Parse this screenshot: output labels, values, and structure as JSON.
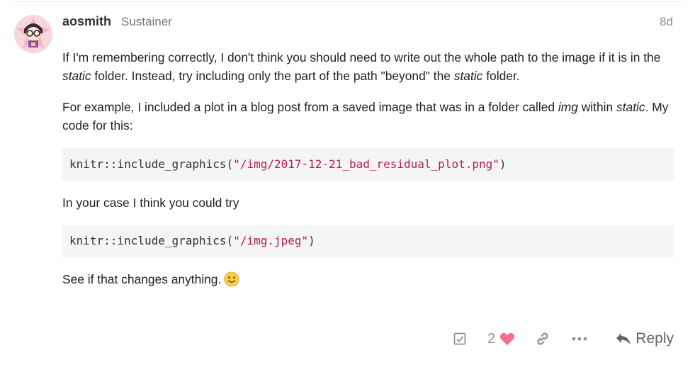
{
  "post": {
    "username": "aosmith",
    "user_title": "Sustainer",
    "age": "8d",
    "avatar_icon": "avatar-cartoon-icon",
    "paragraph1": {
      "a": "If I'm remembering correctly, I don't think you should need to write out the whole path to the image if it is in the ",
      "b": "static",
      "c": " folder. Instead, try including only the part of the path \"beyond\" the ",
      "d": "static",
      "e": " folder."
    },
    "paragraph2": {
      "a": "For example, I included a plot in a blog post from a saved image that was in a folder called ",
      "b": "img",
      "c": " within ",
      "d": "static",
      "e": ". My code for this:"
    },
    "code1": {
      "prefix": "knitr::include_graphics(",
      "string": "\"/img/2017-12-21_bad_residual_plot.png\"",
      "suffix": ")"
    },
    "paragraph3": "In your case I think you could try",
    "code2": {
      "prefix": "knitr::include_graphics(",
      "string": "\"/img.jpeg\"",
      "suffix": ")"
    },
    "paragraph4": "See if that changes anything.",
    "emoji": "slightly-smiling-face-icon"
  },
  "actions": {
    "bookmark_icon": "checkbox-icon",
    "like_count": "2",
    "like_icon": "heart-icon",
    "link_icon": "link-icon",
    "more_icon": "ellipsis-icon",
    "reply_label": "Reply",
    "reply_icon": "reply-arrow-icon"
  },
  "colors": {
    "heart": "#fa6c8d",
    "code_string": "#b3204c",
    "code_bg": "#f5f5f5",
    "muted": "#919191"
  }
}
